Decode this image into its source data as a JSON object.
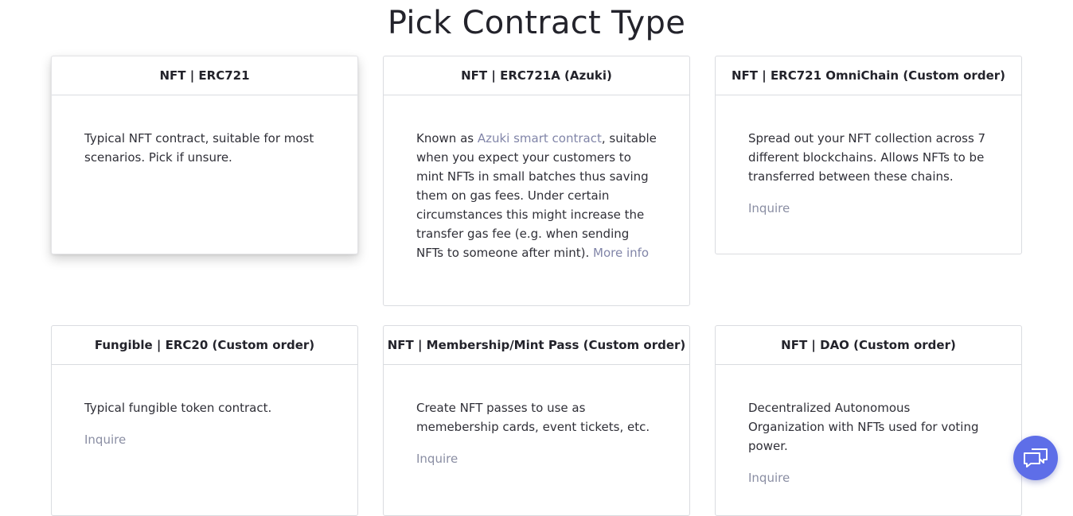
{
  "page": {
    "title": "Pick Contract Type"
  },
  "cards": [
    {
      "header": "NFT | ERC721",
      "desc": "Typical NFT contract, suitable for most scenarios. Pick if unsure."
    },
    {
      "header": "NFT | ERC721A (Azuki)",
      "desc_prefix": "Known as ",
      "desc_link": "Azuki smart contract",
      "desc_suffix": ", suitable when you expect your customers to mint NFTs in small batches thus saving them on gas fees. Under certain circumstances this might increase the transfer gas fee (e.g. when sending NFTs to someone after mint). ",
      "more_link": "More info"
    },
    {
      "header": "NFT | ERC721 OmniChain (Custom order)",
      "desc": "Spread out your NFT collection across 7 different blockchains. Allows NFTs to be transferred between these chains.",
      "inquire": "Inquire"
    },
    {
      "header": "Fungible | ERC20 (Custom order)",
      "desc": "Typical fungible token contract.",
      "inquire": "Inquire"
    },
    {
      "header": "NFT | Membership/Mint Pass (Custom order)",
      "desc": "Create NFT passes to use as memebership cards, event tickets, etc.",
      "inquire": "Inquire"
    },
    {
      "header": "NFT | DAO (Custom order)",
      "desc": "Decentralized Autonomous Organization with NFTs used for voting power.",
      "inquire": "Inquire"
    }
  ],
  "chat_widget": {
    "icon": "chat-bubbles-icon",
    "color": "#5e6ee8"
  }
}
